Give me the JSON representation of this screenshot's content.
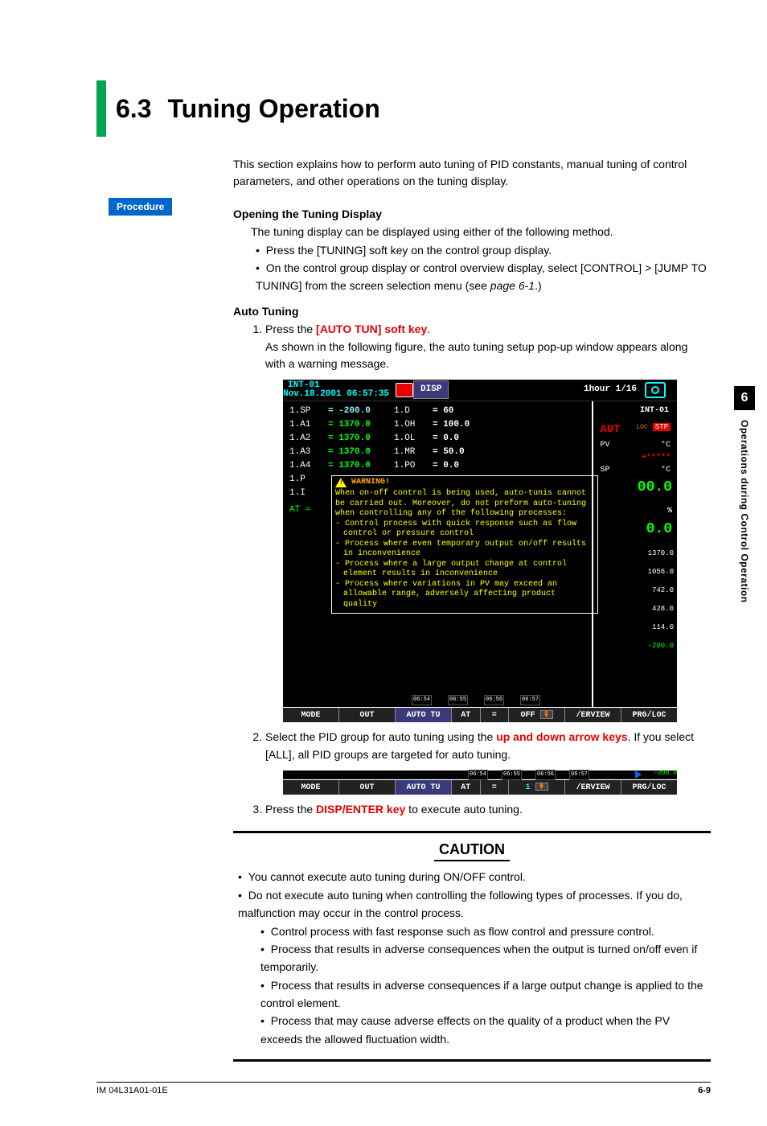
{
  "section": {
    "num": "6.3",
    "title": "Tuning Operation"
  },
  "intro": "This section explains how to perform auto tuning of PID constants, manual tuning of control parameters, and other operations on the tuning display.",
  "procedure_tag": "Procedure",
  "open_heading": "Opening the Tuning Display",
  "open_text": "The tuning display can be displayed using either of the following method.",
  "open_bul1": "Press the [TUNING] soft key on the control group display.",
  "open_bul2_a": "On the control group display or control overview display, select [CONTROL] > [JUMP TO TUNING] from the screen selection menu (see ",
  "open_bul2_ref": "page 6-1",
  "open_bul2_b": ".)",
  "auto_heading": "Auto Tuning",
  "step1a": "Press the ",
  "step1_key": "[AUTO TUN] soft key",
  "step1b": ".",
  "step1_text": "As shown in the following figure, the auto tuning setup pop-up window appears along with a warning message.",
  "step2a": "Select the PID group for auto tuning using the ",
  "step2_key": "up and down arrow keys",
  "step2b": ". If you select [ALL], all PID groups are targeted for auto tuning.",
  "step3a": "Press the ",
  "step3_key": "DISP/ENTER key",
  "step3b": " to execute auto tuning.",
  "caution_title": "CAUTION",
  "caution_b1": "You cannot execute auto tuning during ON/OFF control.",
  "caution_b2": "Do not execute auto tuning when controlling the following types of processes.  If you do, malfunction may occur in the control process.",
  "caution_s1": "Control process with fast response such as flow control and pressure control.",
  "caution_s2": "Process that results in adverse consequences when the output is turned on/off even if temporarily.",
  "caution_s3": "Process that results in adverse consequences if a large output change is applied to the control element.",
  "caution_s4": "Process that may cause adverse effects on the quality of a product when the PV exceeds the allowed fluctuation width.",
  "tab": {
    "num": "6",
    "text": "Operations during Control Operation"
  },
  "footer": {
    "left": "IM 04L31A01-01E",
    "right": "6-9"
  },
  "ss1": {
    "title": "INT-01",
    "date": "Nov.18.2001 06:57:35",
    "disp": "DISP",
    "time": "1hour 1/16",
    "left_rows": [
      {
        "a": "1.SP",
        "b": "= -200.0",
        "bclass": "cyan",
        "c": "1.D",
        "d": "= 60"
      },
      {
        "a": "1.A1",
        "b": "= 1370.0",
        "bclass": "lime",
        "c": "1.OH",
        "d": "= 100.0"
      },
      {
        "a": "1.A2",
        "b": "= 1370.0",
        "bclass": "lime",
        "c": "1.OL",
        "d": "= 0.0"
      },
      {
        "a": "1.A3",
        "b": "= 1370.0",
        "bclass": "lime",
        "c": "1.MR",
        "d": "= 50.0"
      },
      {
        "a": "1.A4",
        "b": "= 1370.0",
        "bclass": "lime",
        "c": "1.PO",
        "d": "= 0.0"
      },
      {
        "a": "1.P",
        "b": "",
        "bclass": "",
        "c": "",
        "d": ""
      },
      {
        "a": "1.I",
        "b": "",
        "bclass": "",
        "c": "",
        "d": ""
      }
    ],
    "at_row": "AT =",
    "warn_label": "WARNING!",
    "warn_intro": "When on-off control is being used, auto-tunis cannot be carried out. Moreover, do not preform auto-tuning when controlling any of the following processes:",
    "warn_d1": "- Control process with quick response such as flow control or pressure control",
    "warn_d2": "- Process where even temporary output on/off results in inconvenience",
    "warn_d3": "- Process where a large output change at control element results in inconvenience",
    "warn_d4": "- Process where variations in PV may exceed an allowable range, adversely affecting product quality",
    "right": {
      "name": "INT-01",
      "aut": "AUT",
      "sub": "LOC",
      "stp": "STP",
      "pv": "PV",
      "pv_unit": "°C",
      "stars": "+*****",
      "sp": "SP",
      "sp_unit": "°C",
      "val1": "00.0",
      "unit1": "%",
      "val2": "0.0",
      "axis": [
        "1370.0",
        "1056.0",
        "742.0",
        "428.0",
        "114.0",
        "-200.0"
      ]
    },
    "softkeys": [
      "MODE",
      "OUT",
      "AUTO TU",
      "AT",
      "=",
      "OFF",
      "/ERVIEW",
      "PRG/LOC"
    ],
    "sel_label": "OFF",
    "barnums": [
      "06:54",
      "06:55",
      "06:56",
      "06:57"
    ]
  },
  "ss2": {
    "softkeys": [
      "MODE",
      "OUT",
      "AUTO TU",
      "AT",
      "=",
      "1",
      "/ERVIEW",
      "PRG/LOC"
    ],
    "corner": "-200.0",
    "barnums": [
      "06:54",
      "06:55",
      "06:56",
      "06:57"
    ]
  }
}
